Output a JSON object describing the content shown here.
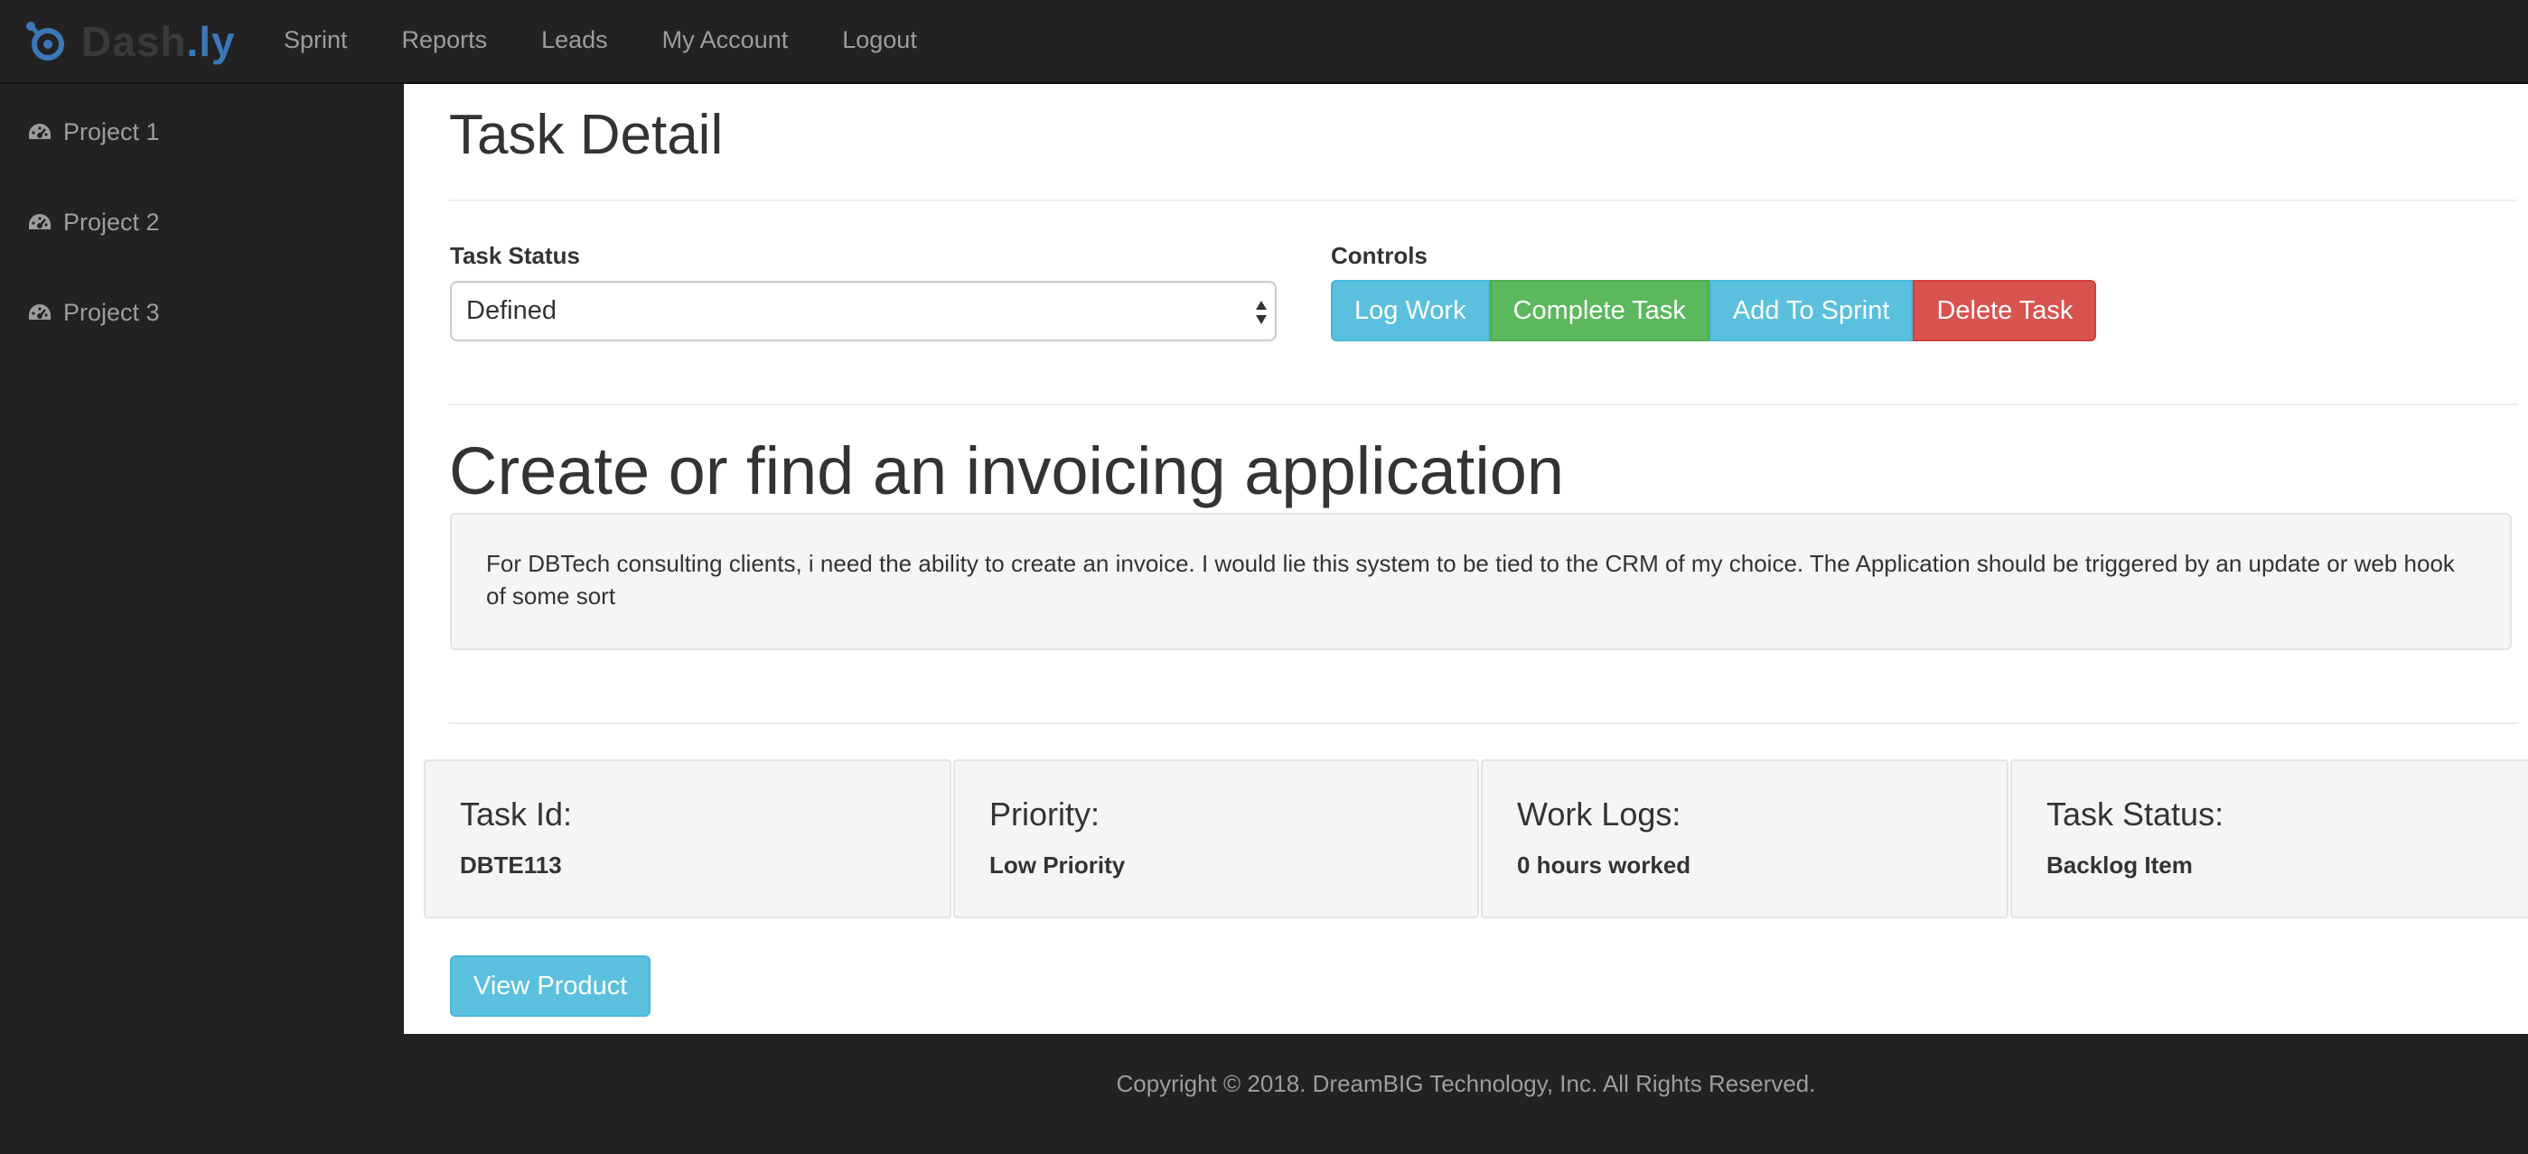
{
  "brand": {
    "name_main": "Dash",
    "name_suffix": ".ly",
    "accent_color": "#3a78b8"
  },
  "nav": {
    "items": [
      {
        "label": "Sprint"
      },
      {
        "label": "Reports"
      },
      {
        "label": "Leads"
      },
      {
        "label": "My Account"
      },
      {
        "label": "Logout"
      }
    ]
  },
  "sidebar": {
    "items": [
      {
        "label": "Project 1",
        "icon": "dashboard-icon"
      },
      {
        "label": "Project 2",
        "icon": "dashboard-icon"
      },
      {
        "label": "Project 3",
        "icon": "dashboard-icon"
      }
    ]
  },
  "page": {
    "title": "Task Detail"
  },
  "status_control": {
    "label": "Task Status",
    "selected": "Defined"
  },
  "controls": {
    "label": "Controls",
    "log_work": "Log Work",
    "complete_task": "Complete Task",
    "add_to_sprint": "Add To Sprint",
    "delete_task": "Delete Task"
  },
  "task": {
    "name": "Create or find an invoicing application",
    "description": "For DBTech consulting clients, i need the ability to create an invoice. I would lie this system to be tied to the CRM of my choice. The Application should be triggered by an update or web hook of some sort"
  },
  "info": {
    "task_id": {
      "title": "Task Id:",
      "value": "DBTE113"
    },
    "priority": {
      "title": "Priority:",
      "value": "Low Priority"
    },
    "work_logs": {
      "title": "Work Logs:",
      "value": "0 hours worked"
    },
    "task_status": {
      "title": "Task Status:",
      "value": "Backlog Item"
    }
  },
  "view_product": "View Product",
  "footer": {
    "copyright": "Copyright © 2018. DreamBIG Technology, Inc. All Rights Reserved."
  },
  "colors": {
    "info": "#5bc0de",
    "success": "#5cb85c",
    "danger": "#d9534f",
    "dark": "#222222"
  }
}
